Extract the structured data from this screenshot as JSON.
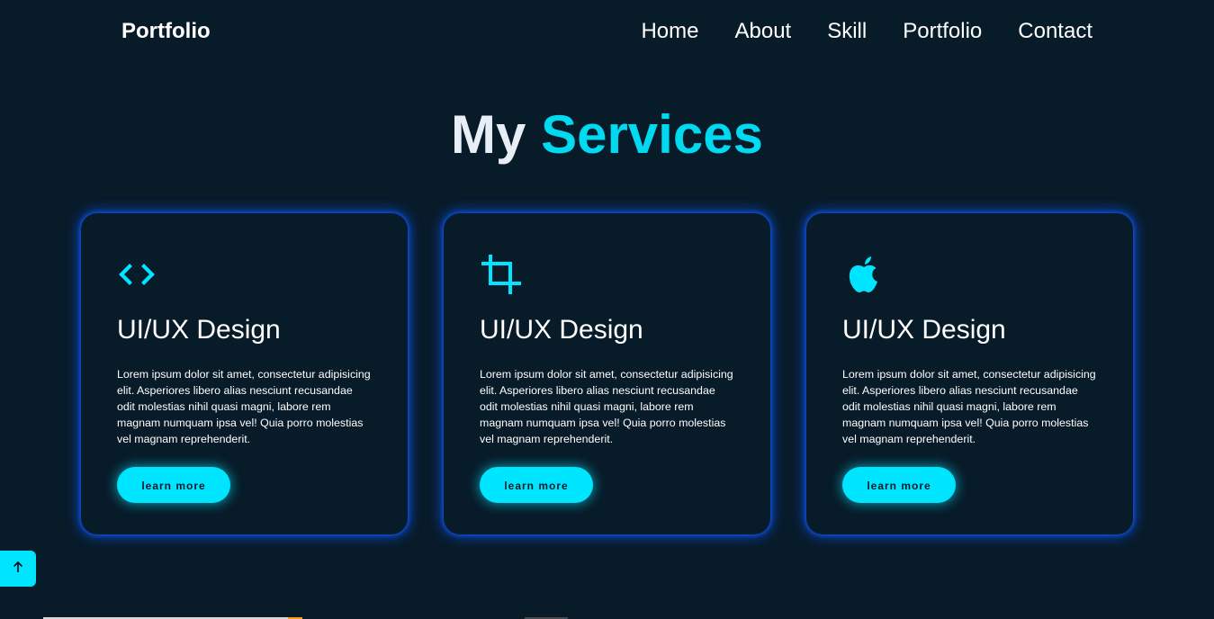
{
  "header": {
    "logo": "Portfolio",
    "nav": [
      "Home",
      "About",
      "Skill",
      "Portfolio",
      "Contact"
    ]
  },
  "services": {
    "title_word1": "My",
    "title_word2": "Services",
    "cards": [
      {
        "icon": "code-icon",
        "title": "UI/UX Design",
        "text": "Lorem ipsum dolor sit amet, consectetur adipisicing elit. Asperiores libero alias nesciunt recusandae odit molestias nihil quasi magni, labore rem magnam numquam ipsa vel! Quia porro molestias vel magnam reprehenderit.",
        "button": "learn more"
      },
      {
        "icon": "crop-icon",
        "title": "UI/UX Design",
        "text": "Lorem ipsum dolor sit amet, consectetur adipisicing elit. Asperiores libero alias nesciunt recusandae odit molestias nihil quasi magni, labore rem magnam numquam ipsa vel! Quia porro molestias vel magnam reprehenderit.",
        "button": "learn more"
      },
      {
        "icon": "apple-icon",
        "title": "UI/UX Design",
        "text": "Lorem ipsum dolor sit amet, consectetur adipisicing elit. Asperiores libero alias nesciunt recusandae odit molestias nihil quasi magni, labore rem magnam numquam ipsa vel! Quia porro molestias vel magnam reprehenderit.",
        "button": "learn more"
      }
    ]
  },
  "scroll_top": {
    "icon": "arrow-up-icon"
  },
  "colors": {
    "background": "#081b29",
    "accent": "#00e5ff",
    "card_glow": "#0a50e6",
    "text": "#ffffff"
  }
}
